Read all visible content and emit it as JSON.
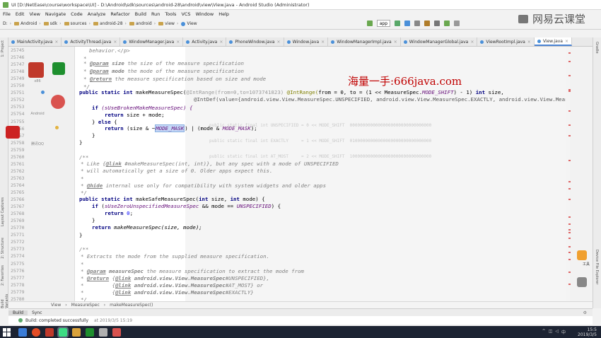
{
  "window": {
    "title": "UI [D:\\NetEase\\course\\workspace\\UI] - D:\\Android\\sdk\\sources\\android-28\\android\\view\\View.java - Android Studio (Administrator)"
  },
  "brand": {
    "text": "网易云课堂"
  },
  "watermark": {
    "text": "海量一手:666java.com"
  },
  "menu": [
    "File",
    "Edit",
    "View",
    "Navigate",
    "Code",
    "Analyze",
    "Refactor",
    "Build",
    "Run",
    "Tools",
    "VCS",
    "Window",
    "Help"
  ],
  "breadcrumb": [
    "D:",
    "Android",
    "sdk",
    "sources",
    "android-28",
    "android",
    "view",
    "View"
  ],
  "run_config": "app",
  "tabs": [
    {
      "label": "MainActivity.java",
      "active": false
    },
    {
      "label": "ActivityThread.java",
      "active": false
    },
    {
      "label": "WindowManager.java",
      "active": false
    },
    {
      "label": "Activity.java",
      "active": false
    },
    {
      "label": "PhoneWindow.java",
      "active": false
    },
    {
      "label": "Window.java",
      "active": false
    },
    {
      "label": "WindowManagerImpl.java",
      "active": false
    },
    {
      "label": "WindowManagerGlobal.java",
      "active": false
    },
    {
      "label": "ViewRootImpl.java",
      "active": false
    },
    {
      "label": "View.java",
      "active": true
    }
  ],
  "left_tool_tabs": [
    "1: Project",
    "Layout Captures",
    "2: Structure",
    "2: Favorites",
    "Build Variants"
  ],
  "right_tool_tabs": [
    "Gradle",
    "Device File Explorer"
  ],
  "line_numbers": [
    "25745",
    "25746",
    "25747",
    "25748",
    "25749",
    "25750",
    "25751",
    "25752",
    "25753",
    "25754",
    "25755",
    "25756",
    "25757",
    "25758",
    "25759",
    "25760",
    "25761",
    "25762",
    "25763",
    "25764",
    "25765",
    "25766",
    "25767",
    "25768",
    "25769",
    "25770",
    "25771",
    "25772",
    "25773",
    "25774",
    "25775",
    "25776",
    "25777",
    "25778",
    "25779",
    "25780"
  ],
  "code": {
    "l0": "behavior.</p>",
    "l1": "*",
    "l2a": "@param",
    "l2b": "size",
    "l2c": " the size of the measure specification",
    "l3a": "@param",
    "l3b": "mode",
    "l3c": " the mode of the measure specification",
    "l4a": "@return",
    "l4b": " the measure specification based on size and mode",
    "l5": "*/",
    "l6a": "public static int ",
    "l6b": "makeMeasureSpec(",
    "l6c": "@IntRange(from=0,to=1073741823)",
    "l6d": " @IntRange(",
    "l6e": "from = 0, to = (1 << MeasureSpec.",
    "l6f": "MODE_SHIFT",
    "l6g": ") - 1) ",
    "l6h": "int",
    "l6i": " size,",
    "l7": "@IntDef(value={android.view.View.MeasureSpec.UNSPECIFIED, android.view.View.MeasureSpec.EXACTLY, android.view.View.MeasureSp",
    "l8a": "if ",
    "l8b": "(sUseBrokenMakeMeasureSpec) {",
    "l9a": "return ",
    "l9b": "size + mode;",
    "l10a": "} ",
    "l10b": "else ",
    "l10c": "{",
    "l11a": "return ",
    "l11b": "(size & ~",
    "l11c": "MODE_MASK",
    "l11d": ") | (mode & ",
    "l11e": "MODE_MASK",
    "l11f": ");",
    "l12": "}",
    "l13": "}",
    "l15": "/**",
    "l16a": "* Like {",
    "l16b": "@link",
    "l16c": " #makeMeasureSpec(int, int)}, but any spec with a mode of UNSPECIFIED",
    "l17": "* will automatically get a size of 0. Older apps expect this.",
    "l18": "*",
    "l19a": "* ",
    "l19b": "@hide",
    "l19c": " internal use only for compatibility with system widgets and older apps",
    "l20": "*/",
    "l21a": "public static int ",
    "l21b": "makeSafeMeasureSpec(",
    "l21c": "int",
    "l21d": " size, ",
    "l21e": "int",
    "l21f": " mode) {",
    "l22a": "if ",
    "l22b": "(",
    "l22c": "sUseZeroUnspecifiedMeasureSpec",
    "l22d": " && mode == ",
    "l22e": "UNSPECIFIED",
    "l22f": ") {",
    "l23a": "return ",
    "l23b": "0",
    "l23c": ";",
    "l24": "}",
    "l25a": "return ",
    "l25b": "makeMeasureSpec(size, mode);",
    "l26": "}",
    "l28": "/**",
    "l29": "* Extracts the mode from the supplied measure specification.",
    "l30": "*",
    "l31a": "* ",
    "l31b": "@param",
    "l31c": " measureSpec",
    "l31d": " the measure specification to extract the mode from",
    "l32a": "* ",
    "l32b": "@return",
    "l32c": " {",
    "l32d": "@link",
    "l32e": " android.view.View.MeasureSpec",
    "l32f": "#UNSPECIFIED},",
    "l33a": "*         {",
    "l33b": "@link",
    "l33c": " android.view.View.MeasureSpec",
    "l33d": "#AT_MOST",
    "l33e": "} or",
    "l34a": "*         {",
    "l34b": "@link",
    "l34c": " android.view.View.MeasureSpec",
    "l34d": "#EXACTLY}",
    "l35": "*/"
  },
  "ghost_text": {
    "g1": "public static final int UNSPECIFIED = 0 << MODE_SHIFT  00000000000000000000000000000000",
    "g2": "public static final int EXACTLY     = 1 << MODE_SHIFT  01000000000000000000000000000000",
    "g3": "public static final int AT_MOST     = 2 << MODE_SHIFT  10000000000000000000000000000000"
  },
  "status_breadcrumb": [
    "View",
    "MeasureSpec",
    "makeMeasureSpec()"
  ],
  "bottom_tabs": [
    "Build",
    "Sync"
  ],
  "build_status": {
    "text": "Build: completed successfully",
    "time": "at 2019/3/5 15:19"
  },
  "desktop_labels": [
    "x86",
    "Android",
    "腾讯QQ"
  ],
  "side_label": "工具",
  "clock": {
    "time": "15:5",
    "date": "2019/3/5"
  },
  "colors": {
    "accent": "#4a83d4",
    "editor_bg": "#ffffff",
    "taskbar": "#1d2433",
    "watermark": "#c00000"
  }
}
